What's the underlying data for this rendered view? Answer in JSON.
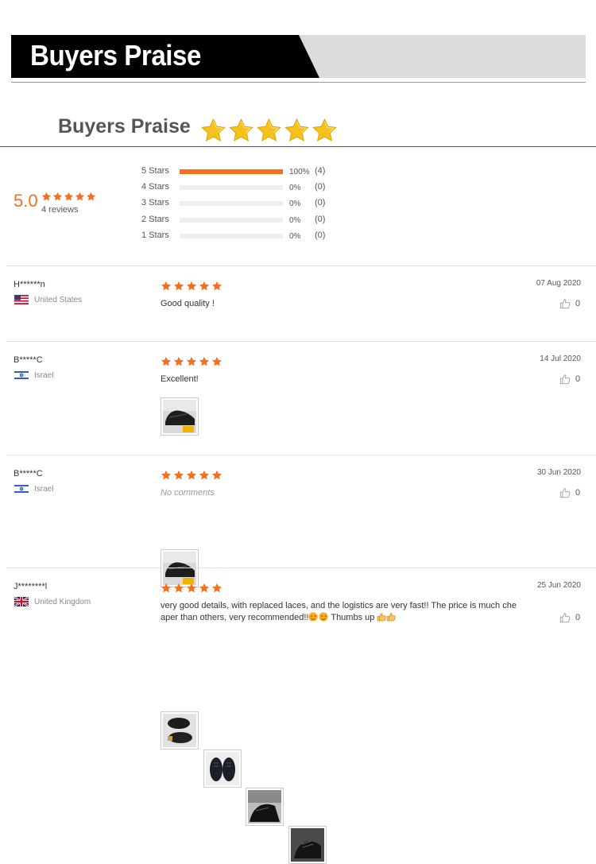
{
  "banner": {
    "title": "Buyers Praise"
  },
  "heading": {
    "title": "Buyers Praise"
  },
  "summary": {
    "score": "5.0",
    "reviews_label": "4 reviews",
    "star_rating": 5,
    "distribution": [
      {
        "label": "5 Stars",
        "fraction": 1.0,
        "pct": "100%",
        "count": "(4)"
      },
      {
        "label": "4 Stars",
        "fraction": 0.0,
        "pct": "0%",
        "count": "(0)"
      },
      {
        "label": "3 Stars",
        "fraction": 0.0,
        "pct": "0%",
        "count": "(0)"
      },
      {
        "label": "2 Stars",
        "fraction": 0.0,
        "pct": "0%",
        "count": "(0)"
      },
      {
        "label": "1 Stars",
        "fraction": 0.0,
        "pct": "0%",
        "count": "(0)"
      }
    ]
  },
  "colors": {
    "accent": "#f46f1f",
    "star_gold": "#f6c219"
  },
  "reviews": [
    {
      "name": "H******n",
      "country": "United States",
      "flag": "us-flag-icon",
      "rating": 5,
      "comment": "Good quality !",
      "date": "07 Aug 2020",
      "likes": "0",
      "photos": 0
    },
    {
      "name": "B*****C",
      "country": "Israel",
      "flag": "israel-flag-icon",
      "rating": 5,
      "comment": "Excellent!",
      "date": "14 Jul 2020",
      "likes": "0",
      "photos": 1
    },
    {
      "name": "B*****C",
      "country": "Israel",
      "flag": "israel-flag-icon",
      "rating": 5,
      "comment": "No comments",
      "date": "30 Jun 2020",
      "likes": "0",
      "photos": 1
    },
    {
      "name": "J********l",
      "country": "United Kingdom",
      "flag": "uk-flag-icon",
      "rating": 5,
      "comment_line1": "very good details, with replaced laces, and the logistics are very fast!! The price is much che",
      "comment_line2_a": "aper than others, very recommended!!",
      "comment_line2_b": "Thumbs up",
      "date": "25 Jun 2020",
      "likes": "0",
      "photos": 4
    }
  ]
}
